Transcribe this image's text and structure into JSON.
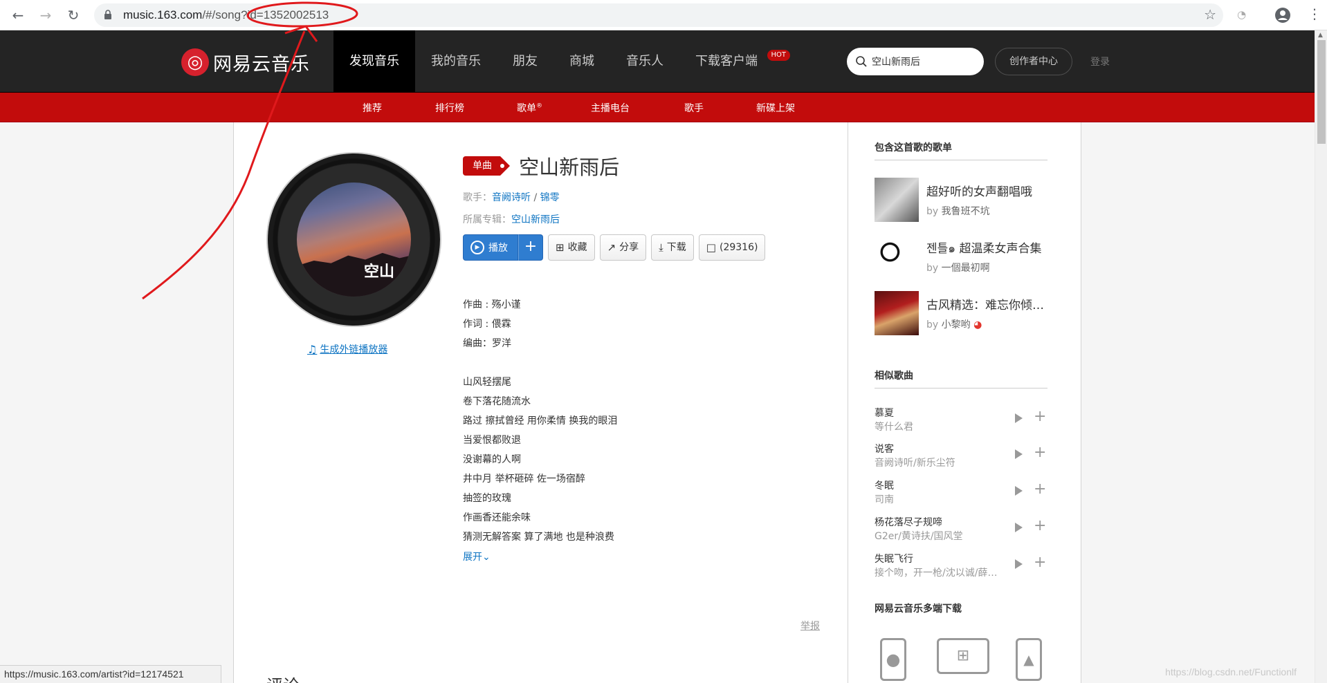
{
  "browser": {
    "url_prefix": "music.163.com",
    "url_path": "/#/song?id=1352002513"
  },
  "header": {
    "logo_text": "网易云音乐",
    "nav": [
      "发现音乐",
      "我的音乐",
      "朋友",
      "商城",
      "音乐人",
      "下载客户端"
    ],
    "hot_badge": "HOT",
    "search_value": "空山新雨后",
    "creator_center": "创作者中心",
    "login": "登录"
  },
  "sub_nav": [
    "推荐",
    "排行榜",
    "歌单",
    "主播电台",
    "歌手",
    "新碟上架"
  ],
  "sub_nav_sup": "®",
  "song": {
    "tag": "单曲",
    "title": "空山新雨后",
    "singer_label": "歌手：",
    "singer_1": "音阙诗听",
    "singer_sep": " / ",
    "singer_2": "锦零",
    "album_label": "所属专辑：",
    "album": "空山新雨后",
    "play": "播放",
    "add": "+",
    "collect": "收藏",
    "share": "分享",
    "download": "下载",
    "comments": "(29316)",
    "cover_mark": "空山"
  },
  "ext_player": "生成外链播放器",
  "lyrics": {
    "credits": [
      "作曲 : 殇小谨",
      "作词 : 偎霖",
      "编曲：罗洋"
    ],
    "lines": [
      "山风轻摆尾",
      "卷下落花随流水",
      "路过 擦拭曾经 用你柔情 换我的眼泪",
      "当爱恨都败退",
      "没谢幕的人啊",
      "井中月 举杯砸碎 佐一场宿醉",
      "抽签的玫瑰",
      "作画香还能余味",
      "猜测无解答案 算了满地 也是种浪费"
    ],
    "expand": "展开"
  },
  "report": "举报",
  "comments_heading": "评论",
  "sidebar": {
    "playlists_title": "包含这首歌的歌单",
    "playlists": [
      {
        "name": "超好听的女声翻唱哦",
        "by": "by",
        "creator": "我鲁班不坑"
      },
      {
        "name": "젠틀๑ 超温柔女声合集",
        "by": "by",
        "creator": "一個最初啊"
      },
      {
        "name": "古风精选：难忘你倾城容颜",
        "by": "by",
        "creator": "小黎哟"
      }
    ],
    "similar_title": "相似歌曲",
    "similar": [
      {
        "name": "慕夏",
        "artist": "等什么君"
      },
      {
        "name": "说客",
        "artist": "音阙诗听/新乐尘符"
      },
      {
        "name": "冬眠",
        "artist": "司南"
      },
      {
        "name": "杨花落尽子规啼",
        "artist": "G2er/黄诗扶/国风堂"
      },
      {
        "name": "失眠飞行",
        "artist": "接个吻，开一枪/沈以诚/薛黛霏"
      }
    ],
    "download_title": "网易云音乐多端下载"
  },
  "status_bar_url": "https://music.163.com/artist?id=12174521",
  "watermark": "https://blog.csdn.net/Functionlf",
  "colors": {
    "brand_red": "#c20c0c",
    "header_dark": "#242424",
    "link_blue": "#0c73c2",
    "play_blue": "#2f7dd0"
  }
}
